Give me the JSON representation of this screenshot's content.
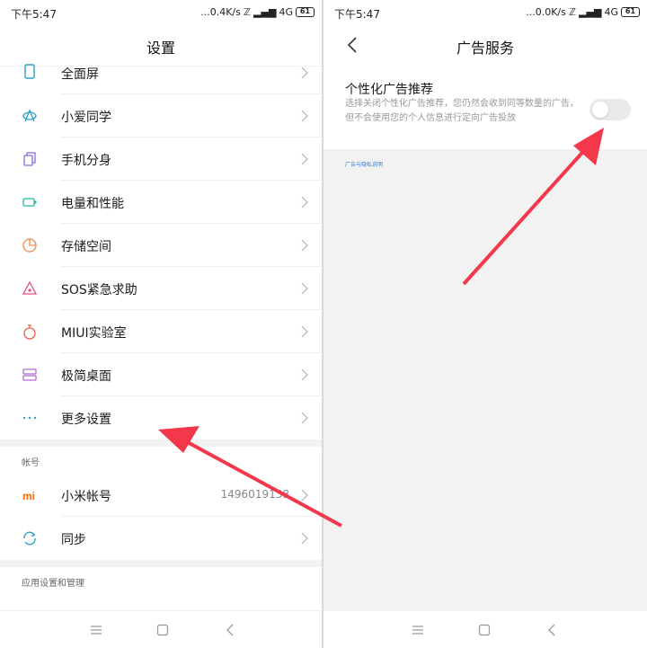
{
  "left": {
    "status": {
      "time": "下午5:47",
      "speed": "...0.4K/s",
      "network": "4G",
      "battery": "61"
    },
    "title": "设置",
    "items": [
      {
        "label": "全面屏",
        "icon": "fullscreen-icon"
      },
      {
        "label": "小爱同学",
        "icon": "xiaoai-icon"
      },
      {
        "label": "手机分身",
        "icon": "second-space-icon"
      },
      {
        "label": "电量和性能",
        "icon": "battery-icon"
      },
      {
        "label": "存储空间",
        "icon": "storage-icon"
      },
      {
        "label": "SOS紧急求助",
        "icon": "sos-icon"
      },
      {
        "label": "MIUI实验室",
        "icon": "lab-icon"
      },
      {
        "label": "极简桌面",
        "icon": "simple-desktop-icon"
      },
      {
        "label": "更多设置",
        "icon": "more-icon"
      }
    ],
    "account_section": "帐号",
    "account_items": [
      {
        "label": "小米帐号",
        "value": "1496019138",
        "icon": "mi-logo-icon"
      },
      {
        "label": "同步",
        "icon": "sync-icon"
      }
    ],
    "apps_section": "应用设置和管理"
  },
  "right": {
    "status": {
      "time": "下午5:47",
      "speed": "...0.0K/s",
      "network": "4G",
      "battery": "61"
    },
    "title": "广告服务",
    "ad_title": "个性化广告推荐",
    "ad_desc": "选择关闭个性化广告推荐，您仍然会收到同等数量的广告，但不会使用您的个人信息进行定向广告投放",
    "toggle_on": false,
    "policy_link": "广告与隐私说明"
  },
  "colors": {
    "accent": "#ff6a00",
    "arrow": "#f2384a",
    "link": "#3b7fd9"
  }
}
